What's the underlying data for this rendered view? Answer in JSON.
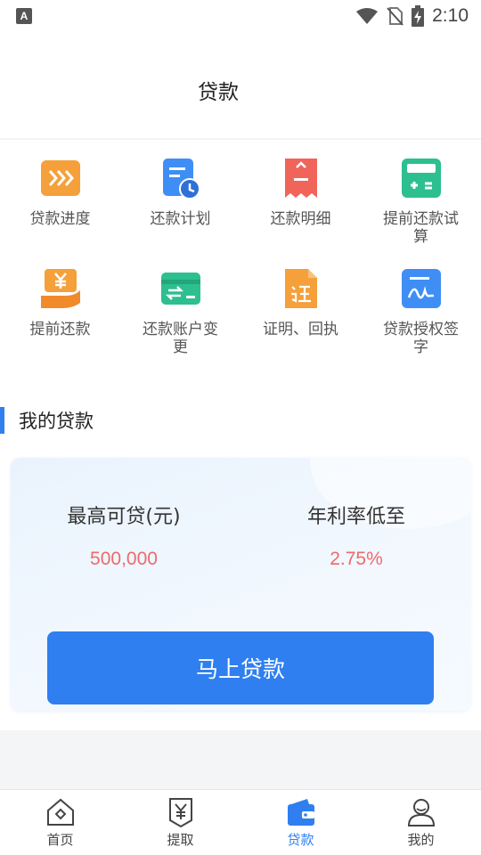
{
  "status_bar": {
    "time": "2:10",
    "app_badge": "A"
  },
  "header": {
    "title": "贷款"
  },
  "services": [
    {
      "label": "贷款进度",
      "icon": "forward-arrows-icon",
      "color": "#f5a03a"
    },
    {
      "label": "还款计划",
      "icon": "calendar-clock-icon",
      "color": "#3f8ef5"
    },
    {
      "label": "还款明细",
      "icon": "receipt-icon",
      "color": "#f0645a"
    },
    {
      "label": "提前还款试算",
      "icon": "calculator-icon",
      "color": "#2dbf8f"
    },
    {
      "label": "提前还款",
      "icon": "yuan-hand-icon",
      "color": "#f5a03a"
    },
    {
      "label": "还款账户变更",
      "icon": "card-exchange-icon",
      "color": "#2dbf8f"
    },
    {
      "label": "证明、回执",
      "icon": "certificate-icon",
      "color": "#f5a03a"
    },
    {
      "label": "贷款授权签字",
      "icon": "signature-icon",
      "color": "#3f8ef5"
    }
  ],
  "section": {
    "title": "我的贷款"
  },
  "loan_card": {
    "max_amount_label": "最高可贷(元)",
    "max_amount_value": "500,000",
    "rate_label": "年利率低至",
    "rate_value": "2.75%",
    "apply_button": "马上贷款"
  },
  "tabs": [
    {
      "label": "首页",
      "icon": "home-icon",
      "active": false
    },
    {
      "label": "提取",
      "icon": "yuan-withdraw-icon",
      "active": false
    },
    {
      "label": "贷款",
      "icon": "wallet-icon",
      "active": true
    },
    {
      "label": "我的",
      "icon": "user-icon",
      "active": false
    }
  ],
  "colors": {
    "accent": "#2f7ff0",
    "value_red": "#ef6a6a"
  }
}
